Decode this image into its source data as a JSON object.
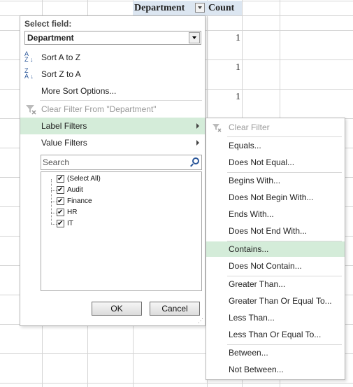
{
  "sheet": {
    "header_department": "Department",
    "header_count": "Count",
    "count_values": [
      "1",
      "1",
      "1"
    ]
  },
  "panel": {
    "select_field_label": "Select field:",
    "select_field_value": "Department",
    "sort_az": "Sort A to Z",
    "sort_za": "Sort Z to A",
    "more_sort": "More Sort Options...",
    "clear_filter": "Clear Filter From \"Department\"",
    "label_filters": "Label Filters",
    "value_filters": "Value Filters",
    "search_placeholder": "Search",
    "items": [
      "(Select All)",
      "Audit",
      "Finance",
      "HR",
      "IT"
    ],
    "ok": "OK",
    "cancel": "Cancel"
  },
  "submenu": {
    "clear_filter": "Clear Filter",
    "equals": "Equals...",
    "does_not_equal": "Does Not Equal...",
    "begins_with": "Begins With...",
    "does_not_begin_with": "Does Not Begin With...",
    "ends_with": "Ends With...",
    "does_not_end_with": "Does Not End With...",
    "contains": "Contains...",
    "does_not_contain": "Does Not Contain...",
    "greater_than": "Greater Than...",
    "greater_than_or_equal": "Greater Than Or Equal To...",
    "less_than": "Less Than...",
    "less_than_or_equal": "Less Than Or Equal To...",
    "between": "Between...",
    "not_between": "Not Between..."
  },
  "colors": {
    "header_fill": "#dce6f1",
    "highlight": "#d4ecd9",
    "grid_line": "#d4d4d4",
    "icon_blue": "#2b579a"
  }
}
